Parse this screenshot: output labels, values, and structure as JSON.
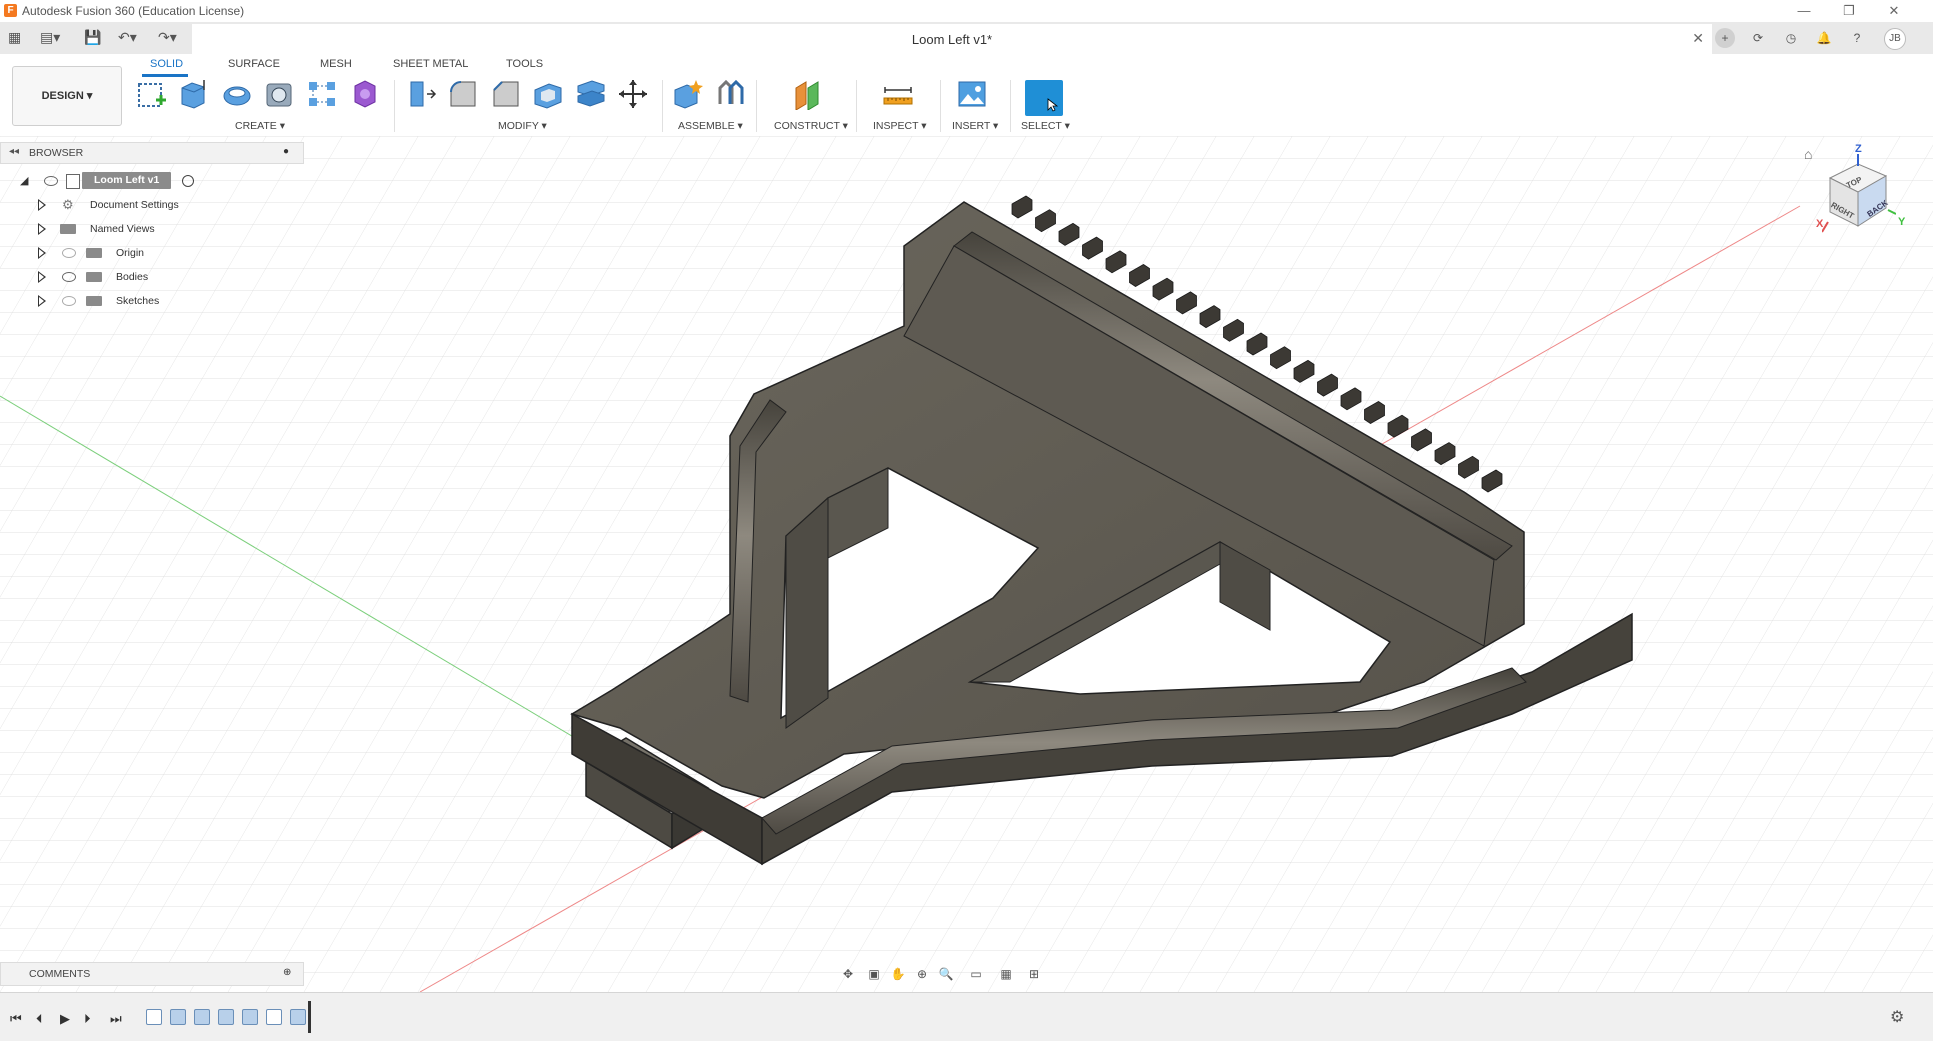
{
  "app": {
    "title": "Autodesk Fusion 360 (Education License)",
    "logo": "F"
  },
  "window_controls": {
    "minimize": "—",
    "restore": "❐",
    "close": "✕"
  },
  "quick_access": {
    "apps": "▦",
    "file": "▤▾",
    "save": "💾",
    "undo": "↶▾",
    "redo": "↷▾"
  },
  "document_tab": {
    "title": "Loom Left v1*",
    "close": "✕"
  },
  "tabbar_icons": {
    "new_tab": "+",
    "jobs": "⟳",
    "clock": "◷",
    "notifications": "🔔",
    "help": "?",
    "user": "JB"
  },
  "ribbon": {
    "tabs": [
      "SOLID",
      "SURFACE",
      "MESH",
      "SHEET METAL",
      "TOOLS"
    ],
    "active_tab": "SOLID",
    "workspace": "DESIGN ▾",
    "groups": [
      "CREATE ▾",
      "MODIFY ▾",
      "ASSEMBLE ▾",
      "CONSTRUCT ▾",
      "INSPECT ▾",
      "INSERT ▾",
      "SELECT ▾"
    ]
  },
  "browser": {
    "title": "BROWSER",
    "root": "Loom Left v1",
    "items": [
      {
        "label": "Document Settings",
        "icon": "gear-icon"
      },
      {
        "label": "Named Views",
        "icon": "folder-icon"
      },
      {
        "label": "Origin",
        "icon": "folder-icon"
      },
      {
        "label": "Bodies",
        "icon": "folder-icon"
      },
      {
        "label": "Sketches",
        "icon": "folder-icon"
      }
    ]
  },
  "comments": {
    "title": "COMMENTS"
  },
  "viewcube": {
    "top": "TOP",
    "right": "RIGHT",
    "back": "BACK",
    "z": "Z",
    "x": "X",
    "y": "Y"
  },
  "timeline": {
    "first": "⏮",
    "prev": "⏴",
    "play": "▶",
    "next": "⏵",
    "last": "⏭"
  },
  "colors": {
    "accent": "#1a74c6",
    "select_button": "#1f8fd6",
    "model": "#5d5950",
    "x_axis": "#e05050",
    "y_axis": "#40c040",
    "z_axis": "#3060d0"
  }
}
